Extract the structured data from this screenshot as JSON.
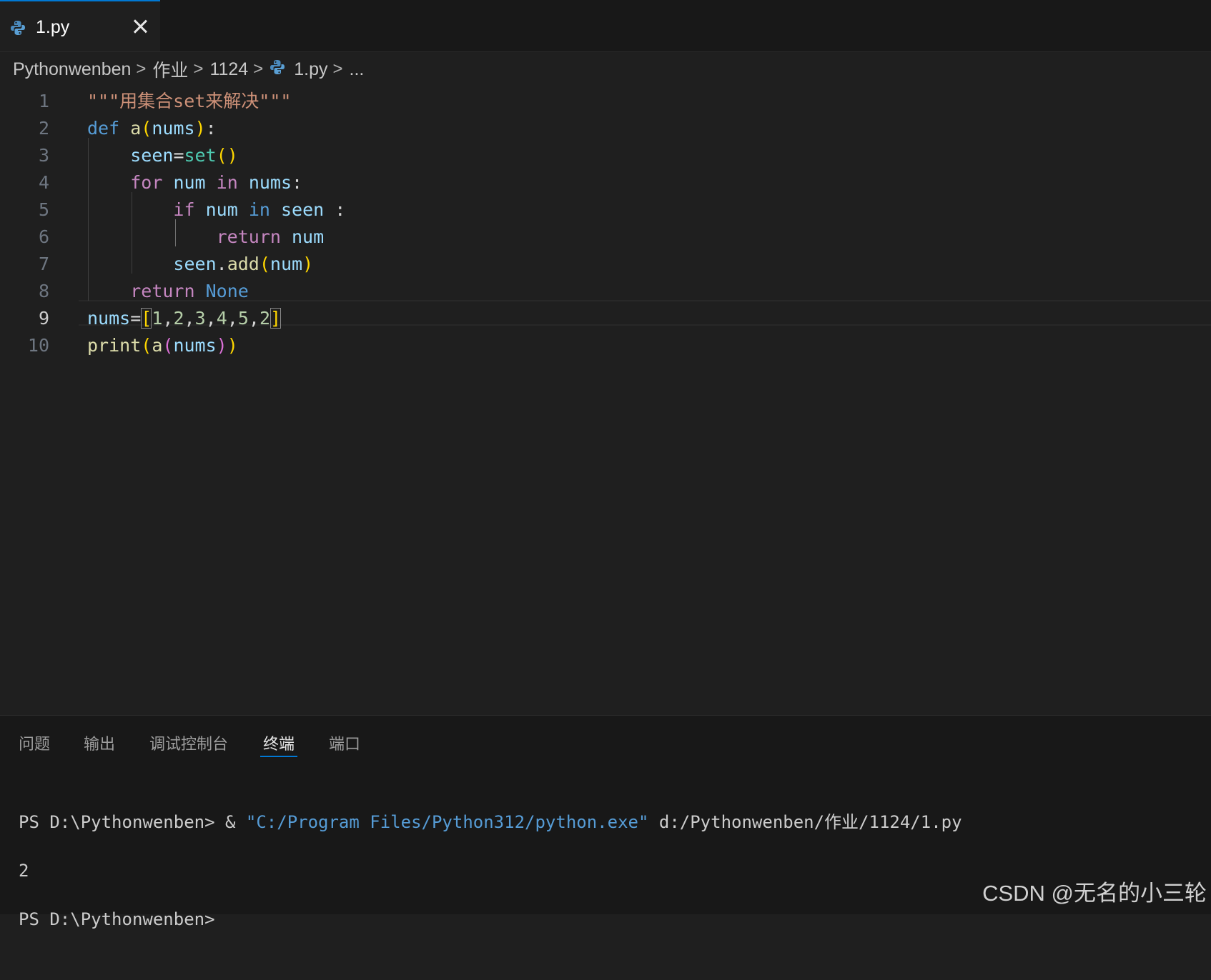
{
  "tab": {
    "label": "1.py",
    "icon": "python-icon"
  },
  "breadcrumb": {
    "items": [
      "Pythonwenben",
      "作业",
      "1124",
      "1.py",
      "..."
    ]
  },
  "editor": {
    "active_line": "9",
    "line_numbers": [
      "1",
      "2",
      "3",
      "4",
      "5",
      "6",
      "7",
      "8",
      "9",
      "10"
    ],
    "lines": [
      [
        {
          "t": "\"\"\"用集合set来解决\"\"\"",
          "c": "str"
        }
      ],
      [
        {
          "t": "def",
          "c": "kw"
        },
        {
          "t": " ",
          "c": "plain"
        },
        {
          "t": "a",
          "c": "fn"
        },
        {
          "t": "(",
          "c": "p1"
        },
        {
          "t": "nums",
          "c": "var"
        },
        {
          "t": ")",
          "c": "p1"
        },
        {
          "t": ":",
          "c": "plain"
        }
      ],
      [
        {
          "t": "    ",
          "c": "plain"
        },
        {
          "t": "seen",
          "c": "var"
        },
        {
          "t": "=",
          "c": "plain"
        },
        {
          "t": "set",
          "c": "builtin"
        },
        {
          "t": "()",
          "c": "p1"
        }
      ],
      [
        {
          "t": "    ",
          "c": "plain"
        },
        {
          "t": "for",
          "c": "ctrl"
        },
        {
          "t": " ",
          "c": "plain"
        },
        {
          "t": "num",
          "c": "var"
        },
        {
          "t": " ",
          "c": "plain"
        },
        {
          "t": "in",
          "c": "ctrl"
        },
        {
          "t": " ",
          "c": "plain"
        },
        {
          "t": "nums",
          "c": "var"
        },
        {
          "t": ":",
          "c": "plain"
        }
      ],
      [
        {
          "t": "        ",
          "c": "plain"
        },
        {
          "t": "if",
          "c": "ctrl"
        },
        {
          "t": " ",
          "c": "plain"
        },
        {
          "t": "num",
          "c": "var"
        },
        {
          "t": " ",
          "c": "plain"
        },
        {
          "t": "in",
          "c": "kw"
        },
        {
          "t": " ",
          "c": "plain"
        },
        {
          "t": "seen",
          "c": "var"
        },
        {
          "t": " :",
          "c": "plain"
        }
      ],
      [
        {
          "t": "            ",
          "c": "plain"
        },
        {
          "t": "return",
          "c": "ctrl"
        },
        {
          "t": " ",
          "c": "plain"
        },
        {
          "t": "num",
          "c": "var"
        }
      ],
      [
        {
          "t": "        ",
          "c": "plain"
        },
        {
          "t": "seen",
          "c": "var"
        },
        {
          "t": ".",
          "c": "plain"
        },
        {
          "t": "add",
          "c": "fn"
        },
        {
          "t": "(",
          "c": "p1"
        },
        {
          "t": "num",
          "c": "var"
        },
        {
          "t": ")",
          "c": "p1"
        }
      ],
      [
        {
          "t": "    ",
          "c": "plain"
        },
        {
          "t": "return",
          "c": "ctrl"
        },
        {
          "t": " ",
          "c": "plain"
        },
        {
          "t": "None",
          "c": "kw"
        }
      ],
      [
        {
          "t": "nums",
          "c": "var"
        },
        {
          "t": "=",
          "c": "plain"
        },
        {
          "t": "[",
          "c": "p1",
          "m": true
        },
        {
          "t": "1",
          "c": "num"
        },
        {
          "t": ",",
          "c": "plain"
        },
        {
          "t": "2",
          "c": "num"
        },
        {
          "t": ",",
          "c": "plain"
        },
        {
          "t": "3",
          "c": "num"
        },
        {
          "t": ",",
          "c": "plain"
        },
        {
          "t": "4",
          "c": "num"
        },
        {
          "t": ",",
          "c": "plain"
        },
        {
          "t": "5",
          "c": "num"
        },
        {
          "t": ",",
          "c": "plain"
        },
        {
          "t": "2",
          "c": "num"
        },
        {
          "t": "]",
          "c": "p1",
          "m": true
        }
      ],
      [
        {
          "t": "print",
          "c": "fn"
        },
        {
          "t": "(",
          "c": "p1"
        },
        {
          "t": "a",
          "c": "fn"
        },
        {
          "t": "(",
          "c": "p2"
        },
        {
          "t": "nums",
          "c": "var"
        },
        {
          "t": ")",
          "c": "p2"
        },
        {
          "t": ")",
          "c": "p1"
        }
      ]
    ]
  },
  "panel": {
    "tabs": [
      "问题",
      "输出",
      "调试控制台",
      "终端",
      "端口"
    ],
    "active_tab": "终端"
  },
  "terminal": {
    "line1_prompt": "PS D:\\Pythonwenben> & ",
    "line1_exe": "\"C:/Program Files/Python312/python.exe\"",
    "line1_arg": " d:/Pythonwenben/作业/1124/1.py",
    "line2": "2",
    "line3": "PS D:\\Pythonwenben>"
  },
  "watermark": "CSDN @无名的小三轮",
  "colors": {
    "accent": "#0078d4",
    "editor_background": "#1f1f1f",
    "panel_background": "#181818"
  }
}
